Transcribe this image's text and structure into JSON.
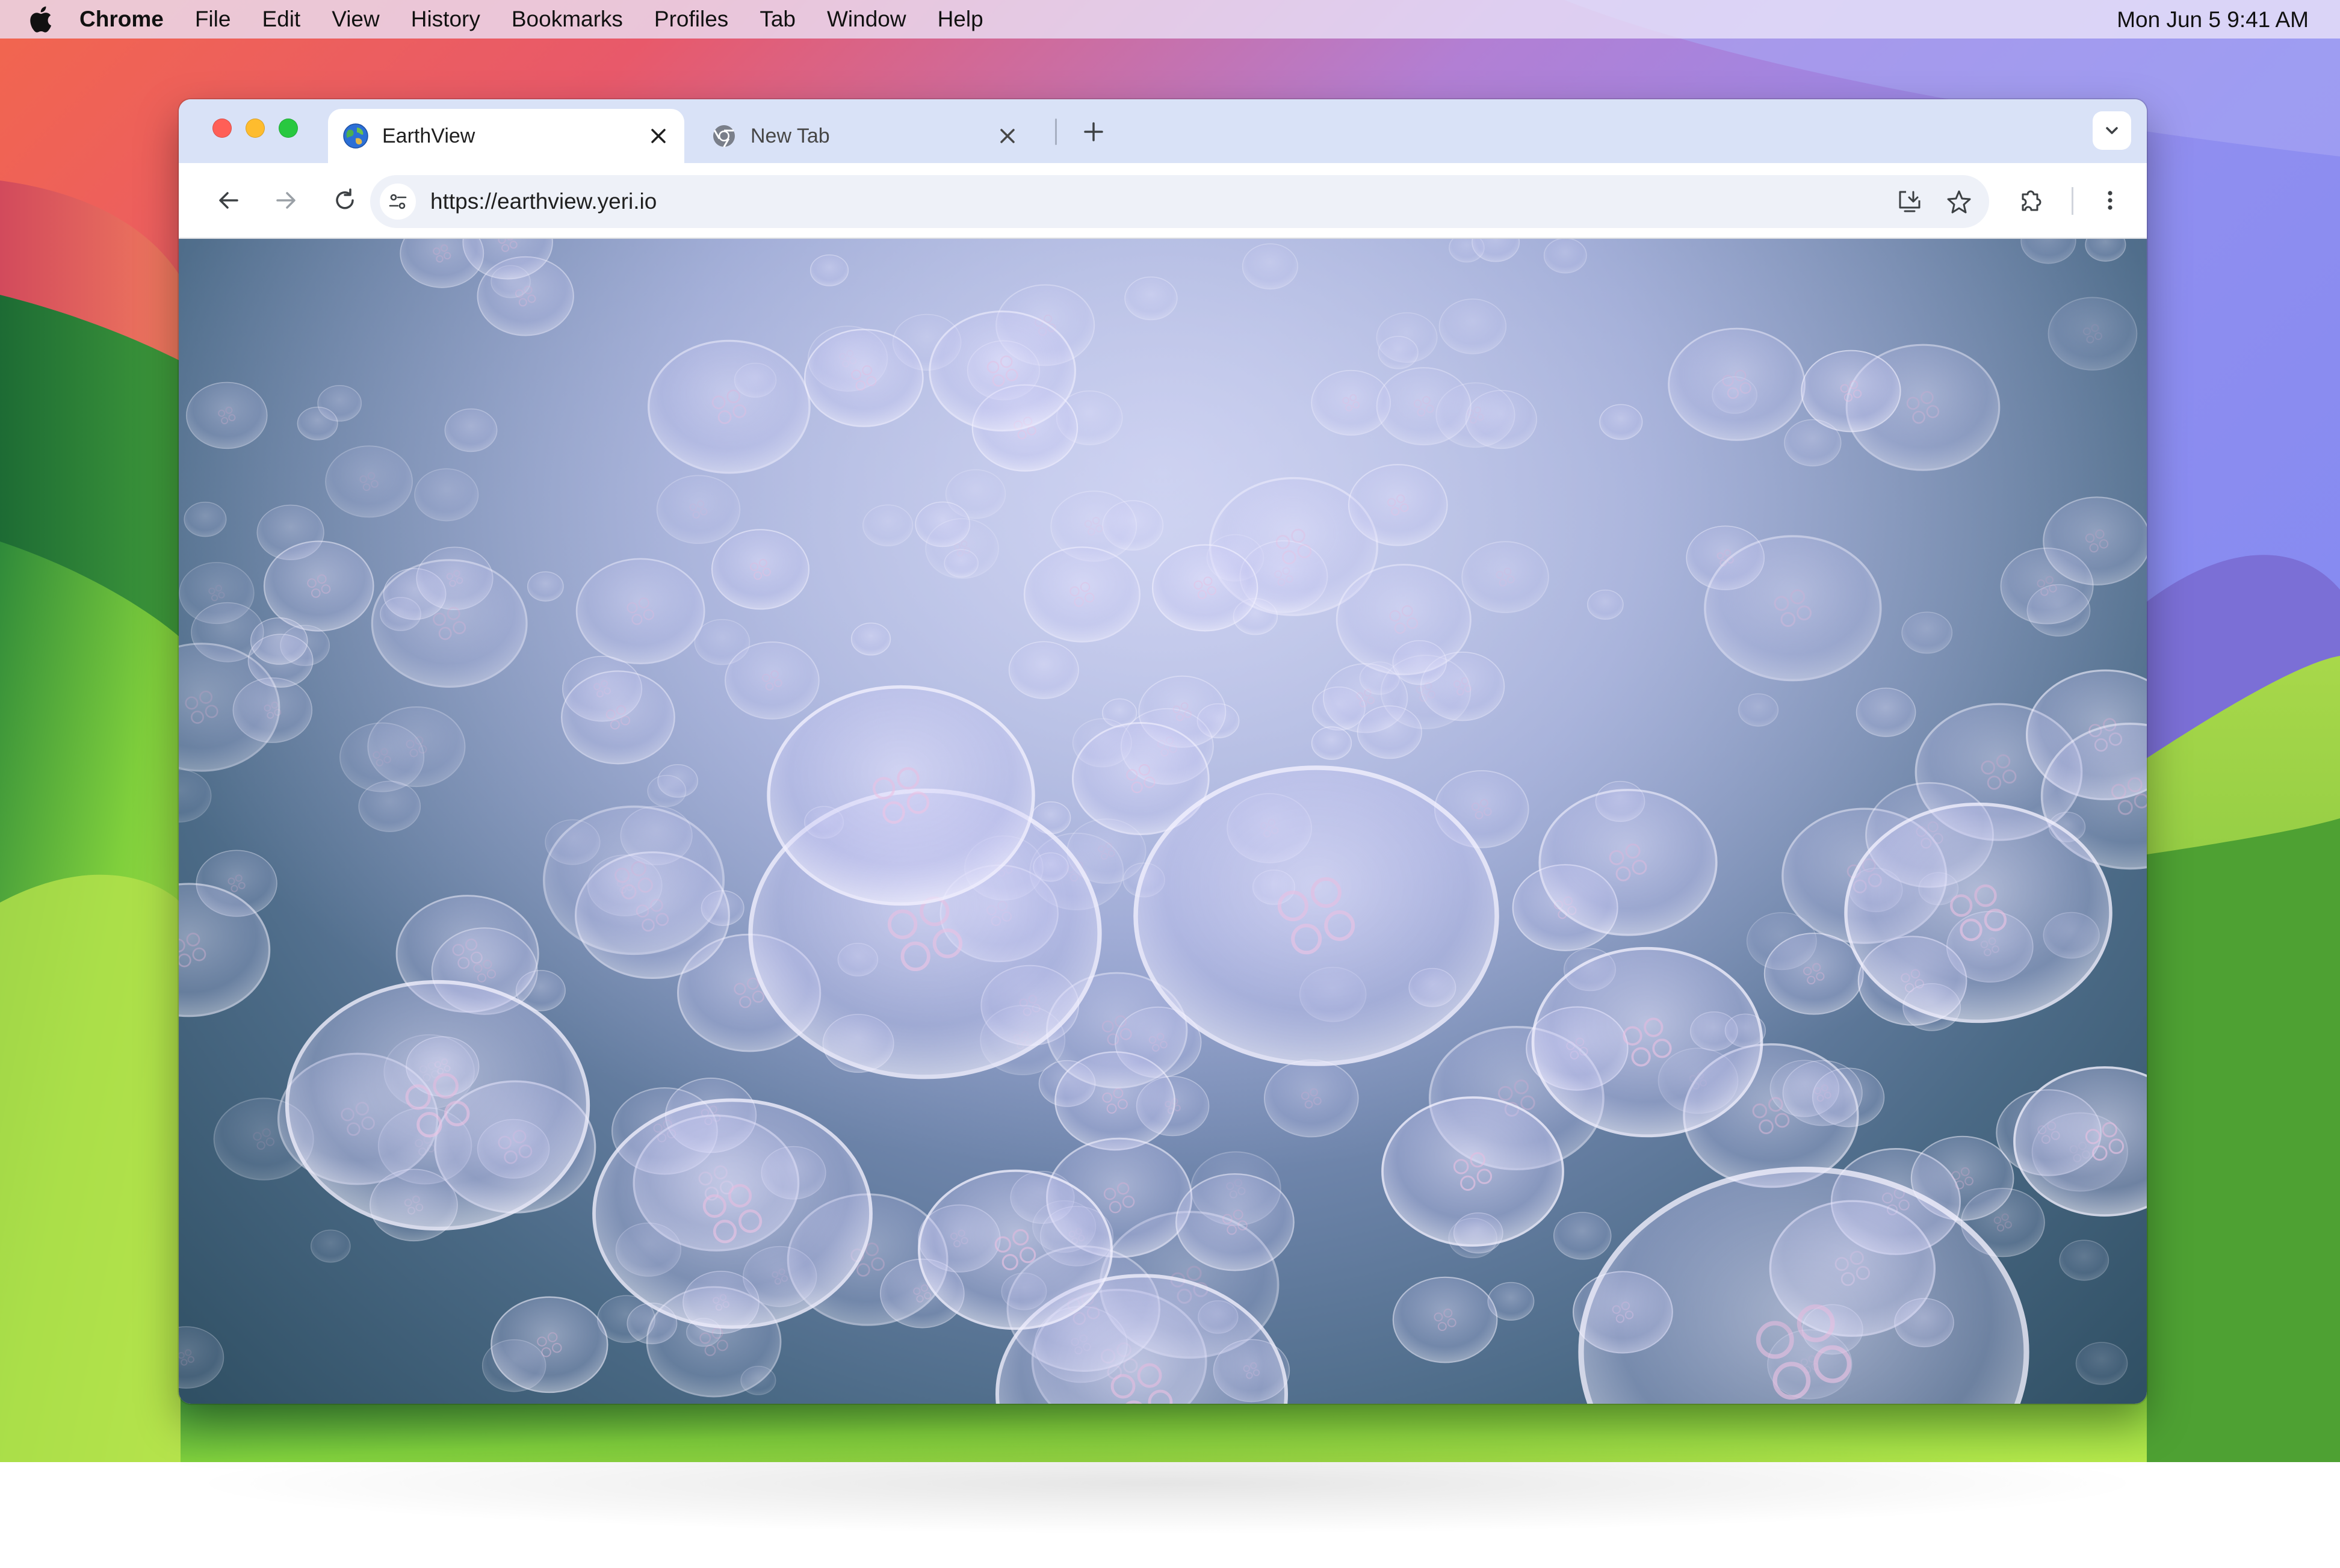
{
  "menubar": {
    "app_name": "Chrome",
    "items": [
      "File",
      "Edit",
      "View",
      "History",
      "Bookmarks",
      "Profiles",
      "Tab",
      "Window",
      "Help"
    ],
    "clock": "Mon Jun 5  9:41 AM"
  },
  "tabs": [
    {
      "title": "EarthView",
      "active": true,
      "favicon": "globe-icon"
    },
    {
      "title": "New Tab",
      "active": false,
      "favicon": "chrome-icon"
    }
  ],
  "toolbar": {
    "url": "https://earthview.yeri.io"
  },
  "content": {
    "description_icon": "jellyfish-photo"
  },
  "colors": {
    "tab_strip": "#d9e2f7",
    "omnibox": "#eef1f8",
    "close_red": "#ff5f57",
    "minimize_yellow": "#febc2e",
    "zoom_green": "#28c840"
  }
}
